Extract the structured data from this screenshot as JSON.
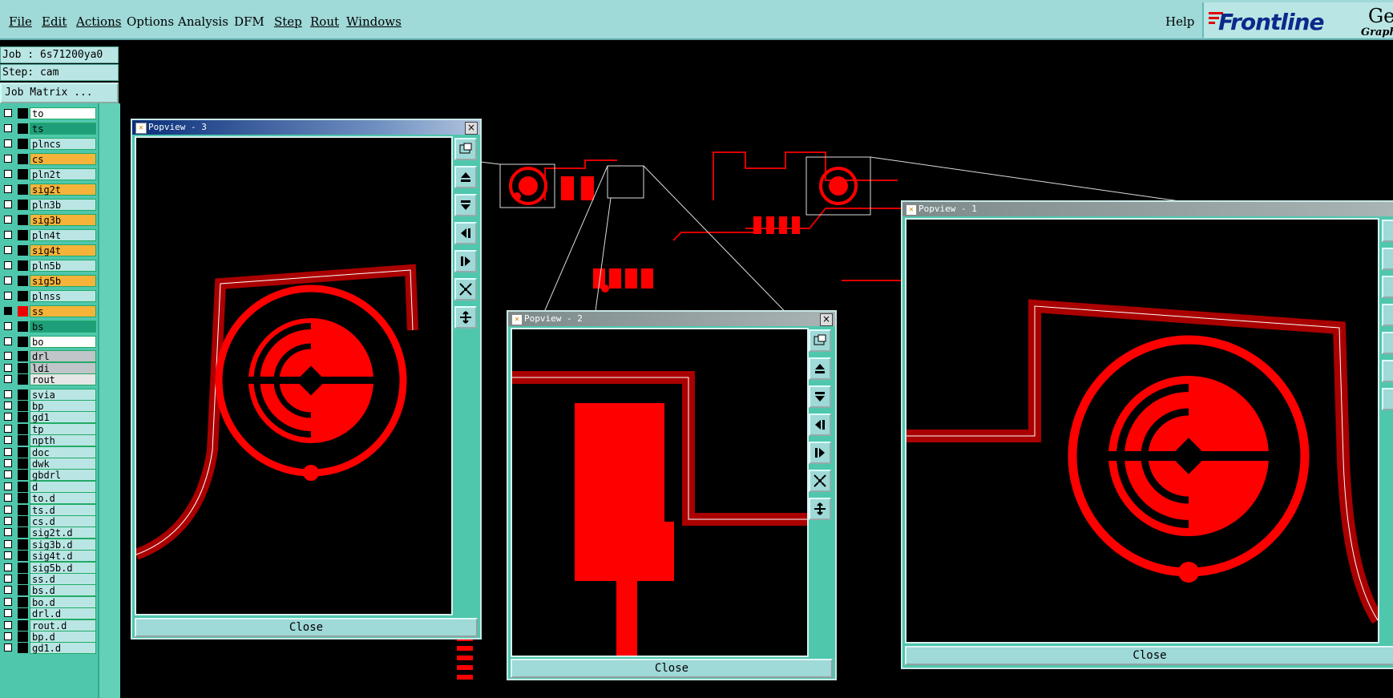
{
  "menubar": {
    "items": [
      "File",
      "Edit",
      "Actions",
      "Options",
      "Analysis",
      "DFM",
      "Step",
      "Rout",
      "Windows"
    ],
    "help": "Help",
    "logo": "Frontline",
    "product": "Genes",
    "product_sub": "Graphi"
  },
  "job": {
    "job_line": "Job : 6s71200ya0",
    "step_line": "Step: cam",
    "matrix_button": "Job Matrix ..."
  },
  "layers": [
    {
      "name": "to",
      "color": "#ffffff",
      "style": "white"
    },
    {
      "name": "ts",
      "color": "#1f9e7a",
      "style": "green"
    },
    {
      "name": "plncs",
      "color": "#b9e6e4",
      "style": "plain"
    },
    {
      "name": "cs",
      "color": "#f6b33a",
      "style": "orange"
    },
    {
      "name": "pln2t",
      "color": "#b9e6e4",
      "style": "plain"
    },
    {
      "name": "sig2t",
      "color": "#f6b33a",
      "style": "orange"
    },
    {
      "name": "pln3b",
      "color": "#b9e6e4",
      "style": "plain"
    },
    {
      "name": "sig3b",
      "color": "#f6b33a",
      "style": "orange"
    },
    {
      "name": "pln4t",
      "color": "#b9e6e4",
      "style": "plain"
    },
    {
      "name": "sig4t",
      "color": "#f6b33a",
      "style": "orange"
    },
    {
      "name": "pln5b",
      "color": "#b9e6e4",
      "style": "plain"
    },
    {
      "name": "sig5b",
      "color": "#f6b33a",
      "style": "orange"
    },
    {
      "name": "plnss",
      "color": "#b9e6e4",
      "style": "plain"
    },
    {
      "name": "ss",
      "color": "#f6b33a",
      "style": "orange-active"
    },
    {
      "name": "bs",
      "color": "#1f9e7a",
      "style": "green"
    },
    {
      "name": "bo",
      "color": "#ffffff",
      "style": "white"
    },
    {
      "name": "drl",
      "color": "#bfc5c8",
      "style": "grey"
    },
    {
      "name": "ldi",
      "color": "#bfc5c8",
      "style": "grey"
    },
    {
      "name": "rout",
      "color": "#e6e6e6",
      "style": "lightgrey"
    },
    {
      "name": "svia",
      "color": "#b9e6e4",
      "style": "plain"
    },
    {
      "name": "bp",
      "color": "#b9e6e4",
      "style": "plain"
    },
    {
      "name": "gd1",
      "color": "#b9e6e4",
      "style": "plain"
    },
    {
      "name": "tp",
      "color": "#b9e6e4",
      "style": "plain"
    },
    {
      "name": "npth",
      "color": "#b9e6e4",
      "style": "plain"
    },
    {
      "name": "doc",
      "color": "#b9e6e4",
      "style": "plain"
    },
    {
      "name": "dwk",
      "color": "#b9e6e4",
      "style": "plain"
    },
    {
      "name": "gbdrl",
      "color": "#b9e6e4",
      "style": "plain"
    },
    {
      "name": "d",
      "color": "#b9e6e4",
      "style": "plain"
    },
    {
      "name": "to.d",
      "color": "#b9e6e4",
      "style": "plain"
    },
    {
      "name": "ts.d",
      "color": "#b9e6e4",
      "style": "plain"
    },
    {
      "name": "cs.d",
      "color": "#b9e6e4",
      "style": "plain"
    },
    {
      "name": "sig2t.d",
      "color": "#b9e6e4",
      "style": "plain"
    },
    {
      "name": "sig3b.d",
      "color": "#b9e6e4",
      "style": "plain"
    },
    {
      "name": "sig4t.d",
      "color": "#b9e6e4",
      "style": "plain"
    },
    {
      "name": "sig5b.d",
      "color": "#b9e6e4",
      "style": "plain"
    },
    {
      "name": "ss.d",
      "color": "#b9e6e4",
      "style": "plain"
    },
    {
      "name": "bs.d",
      "color": "#b9e6e4",
      "style": "plain"
    },
    {
      "name": "bo.d",
      "color": "#b9e6e4",
      "style": "plain"
    },
    {
      "name": "drl.d",
      "color": "#b9e6e4",
      "style": "plain"
    },
    {
      "name": "rout.d",
      "color": "#b9e6e4",
      "style": "plain"
    },
    {
      "name": "bp.d",
      "color": "#b9e6e4",
      "style": "plain"
    },
    {
      "name": "gd1.d",
      "color": "#b9e6e4",
      "style": "plain"
    }
  ],
  "popviews": [
    {
      "title": "Popview - 3",
      "close": "Close"
    },
    {
      "title": "Popview - 2",
      "close": "Close"
    },
    {
      "title": "Popview - 1",
      "close": "Close"
    }
  ],
  "colors": {
    "copper": "#ff0000",
    "dark_copper": "#a00000",
    "accent": "#4fc7ad",
    "menu_bg": "#9fd9d8"
  }
}
